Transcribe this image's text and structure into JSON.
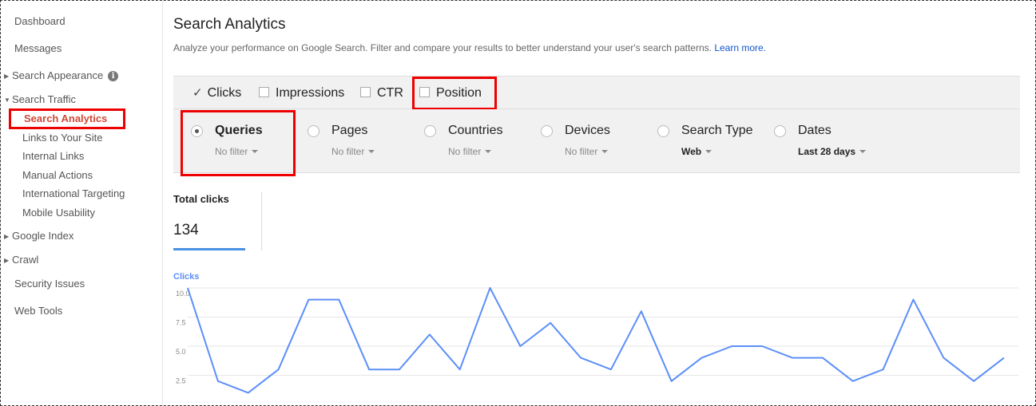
{
  "sidebar": {
    "dashboard": "Dashboard",
    "messages": "Messages",
    "search_appearance": "Search Appearance",
    "search_traffic": "Search Traffic",
    "search_analytics": "Search Analytics",
    "links_to_site": "Links to Your Site",
    "internal_links": "Internal Links",
    "manual_actions": "Manual Actions",
    "international_targeting": "International Targeting",
    "mobile_usability": "Mobile Usability",
    "google_index": "Google Index",
    "crawl": "Crawl",
    "security_issues": "Security Issues",
    "web_tools": "Web Tools"
  },
  "header": {
    "title": "Search Analytics",
    "subtitle": "Analyze your performance on Google Search. Filter and compare your results to better understand your user's search patterns.",
    "learn_more": "Learn more."
  },
  "metrics": [
    {
      "label": "Clicks",
      "checked": true
    },
    {
      "label": "Impressions",
      "checked": false
    },
    {
      "label": "CTR",
      "checked": false
    },
    {
      "label": "Position",
      "checked": false
    }
  ],
  "dimensions": [
    {
      "label": "Queries",
      "filter": "No filter",
      "selected": true
    },
    {
      "label": "Pages",
      "filter": "No filter",
      "selected": false
    },
    {
      "label": "Countries",
      "filter": "No filter",
      "selected": false
    },
    {
      "label": "Devices",
      "filter": "No filter",
      "selected": false
    },
    {
      "label": "Search Type",
      "filter": "Web",
      "selected": false
    },
    {
      "label": "Dates",
      "filter": "Last 28 days",
      "selected": false
    }
  ],
  "totals": {
    "label": "Total clicks",
    "value": "134"
  },
  "chart_data": {
    "type": "line",
    "series": [
      {
        "name": "Clicks",
        "values": [
          10,
          2,
          1,
          3,
          9,
          9,
          3,
          3,
          6,
          3,
          10,
          5,
          7,
          4,
          3,
          8,
          2,
          4,
          5,
          5,
          4,
          4,
          2,
          3,
          9,
          4,
          2,
          4
        ]
      }
    ],
    "yticks": [
      "10.0",
      "7.5",
      "5.0",
      "2.5"
    ],
    "ylim": [
      0,
      10
    ],
    "grid": true,
    "line_color": "#5b8ff9"
  }
}
